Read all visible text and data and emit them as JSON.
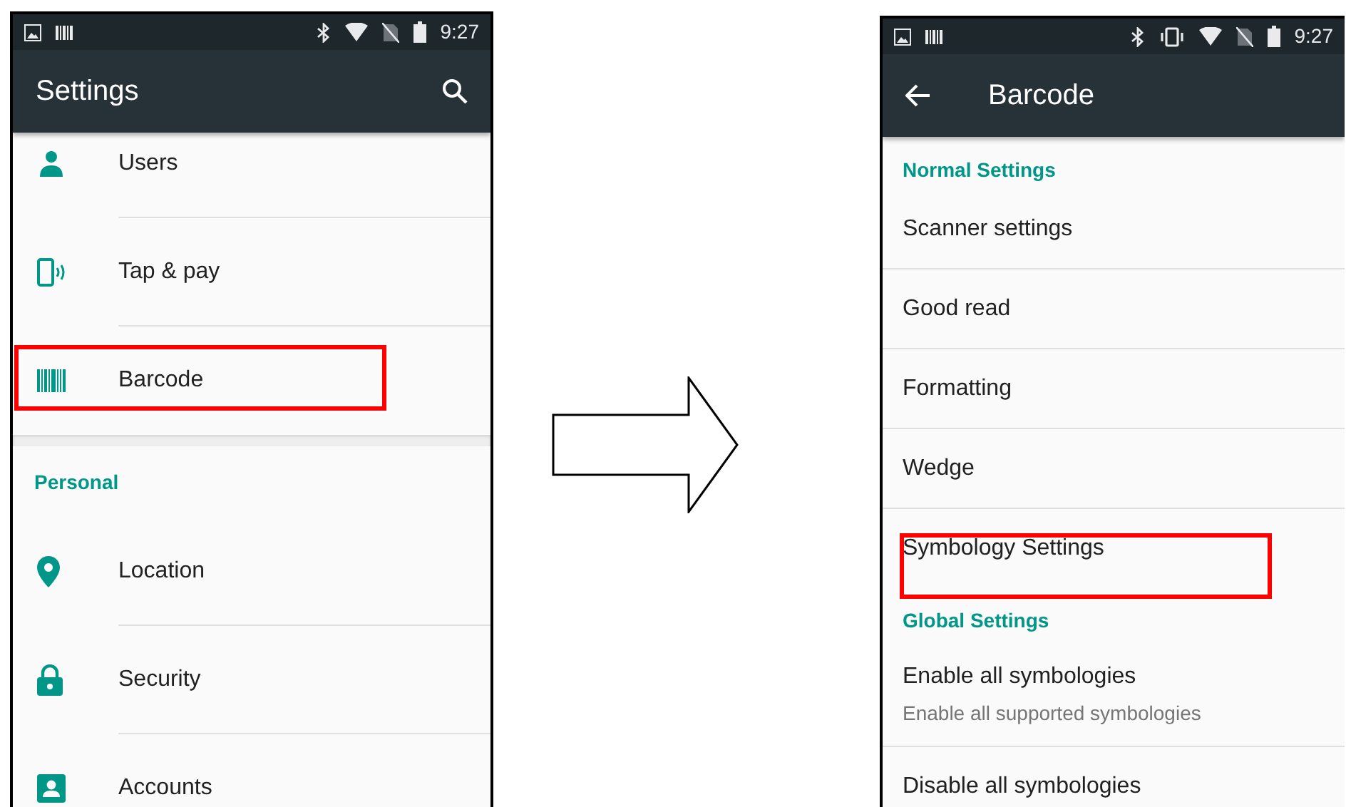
{
  "screens": [
    {
      "status_bar": {
        "time": "9:27"
      },
      "app_bar": {
        "title": "Settings"
      },
      "rows": [
        {
          "kind": "item",
          "label": "Users",
          "highlighted": false
        },
        {
          "kind": "item",
          "label": "Tap & pay",
          "highlighted": false
        },
        {
          "kind": "item",
          "label": "Barcode",
          "highlighted": true
        },
        {
          "kind": "gap"
        },
        {
          "kind": "header",
          "label": "Personal"
        },
        {
          "kind": "item",
          "label": "Location",
          "highlighted": false
        },
        {
          "kind": "item",
          "label": "Security",
          "highlighted": false
        },
        {
          "kind": "item",
          "label": "Accounts",
          "highlighted": false
        }
      ]
    },
    {
      "status_bar": {
        "time": "9:27"
      },
      "app_bar": {
        "title": "Barcode"
      },
      "rows": [
        {
          "kind": "header",
          "label": "Normal Settings"
        },
        {
          "kind": "plain",
          "label": "Scanner settings",
          "highlighted": false
        },
        {
          "kind": "plain",
          "label": "Good read",
          "highlighted": false
        },
        {
          "kind": "plain",
          "label": "Formatting",
          "highlighted": false
        },
        {
          "kind": "plain",
          "label": "Wedge",
          "highlighted": false
        },
        {
          "kind": "plain",
          "label": "Symbology Settings",
          "highlighted": true
        },
        {
          "kind": "header",
          "label": "Global Settings"
        },
        {
          "kind": "plain",
          "label": "Enable all symbologies",
          "summary": "Enable all supported symbologies",
          "highlighted": false
        },
        {
          "kind": "plain",
          "label": "Disable all symbologies",
          "highlighted": false
        }
      ]
    }
  ]
}
